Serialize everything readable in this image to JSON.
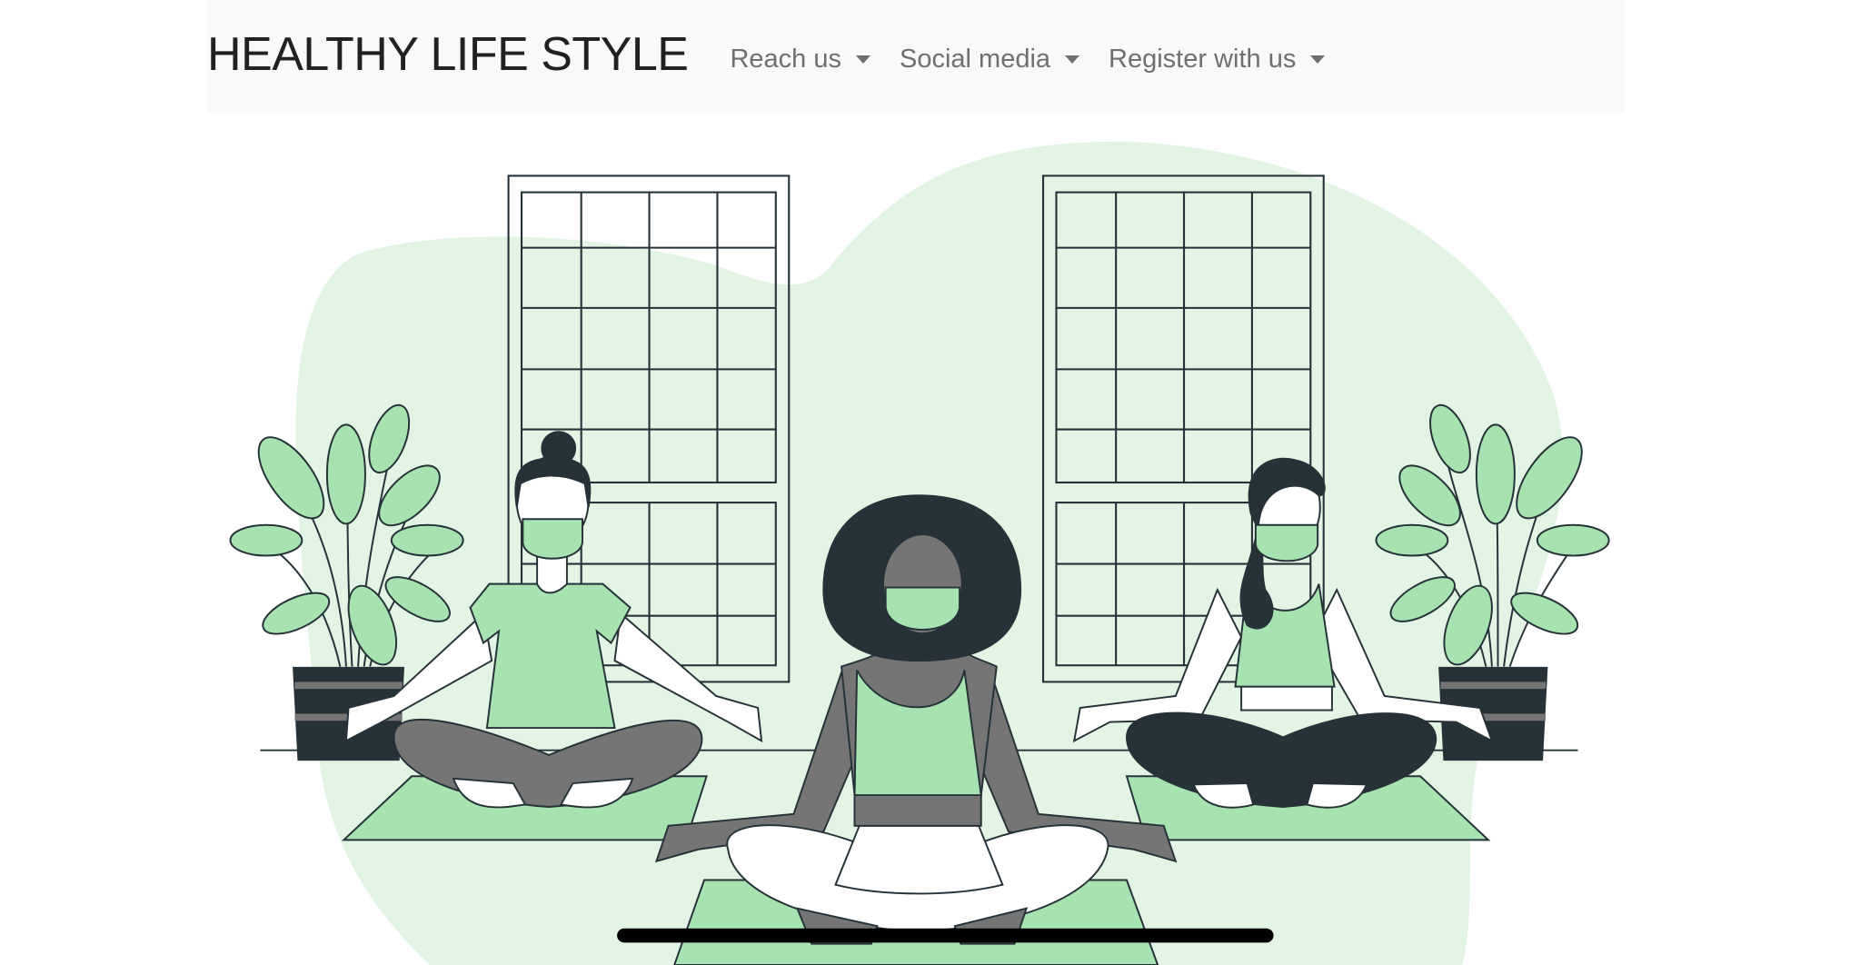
{
  "navbar": {
    "brand": "HEALTHY LIFE STYLE",
    "items": [
      {
        "label": "Reach us",
        "icon": "caret-down-icon"
      },
      {
        "label": "Social media",
        "icon": "caret-down-icon"
      },
      {
        "label": "Register with us",
        "icon": "caret-down-icon"
      }
    ]
  },
  "colors": {
    "navbar_bg": "#f8f9fa",
    "blob": "#e2f4e4",
    "accent_green": "#a6e3b0",
    "dark": "#263238",
    "grey": "#757575"
  }
}
